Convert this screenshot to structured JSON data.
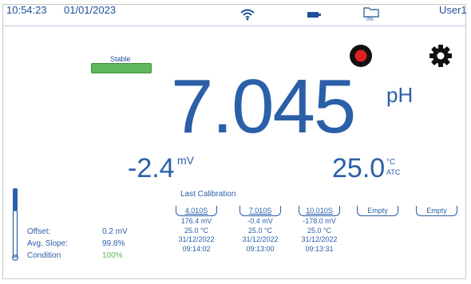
{
  "statusbar": {
    "time": "10:54:23",
    "date": "01/01/2023",
    "storage_percent": "0%",
    "user": "User1"
  },
  "stability": {
    "label": "Stable",
    "color": "#5fb85c"
  },
  "reading": {
    "value": "7.045",
    "unit": "pH",
    "mv_value": "-2.4",
    "mv_unit": "mV",
    "temp_value": "25.0",
    "temp_unit": "°C",
    "temp_mode": "ATC"
  },
  "electrode": {
    "offset_label": "Offset:",
    "offset_value": "0.2 mV",
    "slope_label": "Avg. Slope:",
    "slope_value": "99.8%",
    "condition_label": "Condition",
    "condition_value": "100%",
    "condition_color": "#5fb85c"
  },
  "calibration": {
    "title": "Last Calibration",
    "points": [
      {
        "buffer": "4.010S",
        "mv": "176.4 mV",
        "temp": "25.0 °C",
        "date": "31/12/2022",
        "time": "09:14:02"
      },
      {
        "buffer": "7.010S",
        "mv": "-0.4 mV",
        "temp": "25.0 °C",
        "date": "31/12/2022",
        "time": "09:13:00"
      },
      {
        "buffer": "10.010S",
        "mv": "-178.0 mV",
        "temp": "25.0 °C",
        "date": "31/12/2022",
        "time": "09:13:31"
      },
      {
        "buffer": "Empty"
      },
      {
        "buffer": "Empty"
      }
    ]
  },
  "icons": [
    "wifi-icon",
    "battery-icon",
    "folder-icon",
    "record-icon",
    "gear-icon",
    "electrode-icon"
  ],
  "colors": {
    "accent": "#2b5fa8",
    "record": "#e02020",
    "stable": "#5fb85c"
  }
}
